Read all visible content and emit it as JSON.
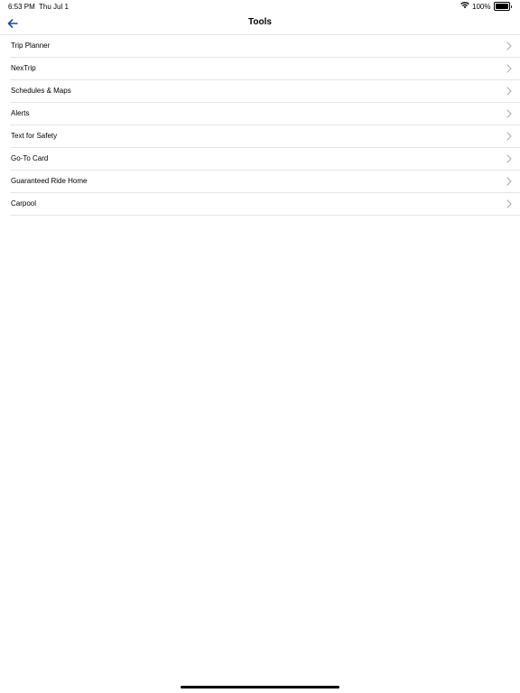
{
  "status_bar": {
    "time": "6:53 PM",
    "date": "Thu Jul 1",
    "battery_percent": "100%",
    "battery_level": 1.0
  },
  "nav": {
    "title": "Tools",
    "back_icon": "arrow-left-icon",
    "back_icon_color": "#1a4fa0"
  },
  "list": {
    "items": [
      {
        "label": "Trip Planner"
      },
      {
        "label": "NexTrip"
      },
      {
        "label": "Schedules & Maps"
      },
      {
        "label": "Alerts"
      },
      {
        "label": "Text for Safety"
      },
      {
        "label": "Go-To Card"
      },
      {
        "label": "Guaranteed Ride Home"
      },
      {
        "label": "Carpool"
      }
    ],
    "chevron_icon": "chevron-right-icon",
    "chevron_color": "#b0b0b0"
  }
}
